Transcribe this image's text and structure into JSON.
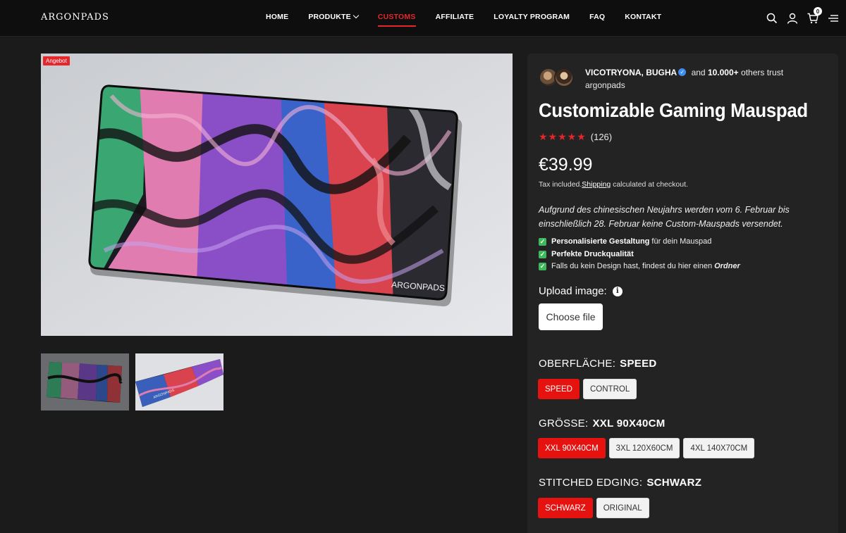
{
  "brand": {
    "logo": "ARGONPADS"
  },
  "nav": {
    "items": [
      {
        "label": "HOME"
      },
      {
        "label": "PRODUKTE"
      },
      {
        "label": "CUSTOMS"
      },
      {
        "label": "AFFILIATE"
      },
      {
        "label": "LOYALTY PROGRAM"
      },
      {
        "label": "FAQ"
      },
      {
        "label": "KONTAKT"
      }
    ],
    "active": "CUSTOMS",
    "cart_count": "0"
  },
  "gallery": {
    "sale_badge": "Angebot",
    "mousepad_brand": "ARGONPADS",
    "thumb_brand": "ARGONPADS"
  },
  "product": {
    "trust": {
      "names": "VICOTRYONA, BUGHA",
      "and": "and",
      "count": "10.000+",
      "rest": "others trust argonpads"
    },
    "title": "Customizable Gaming Mauspad",
    "stars": "★★★★★",
    "rating_count": "(126)",
    "price": "€39.99",
    "tax_prefix": "Tax included.",
    "tax_link": "Shipping",
    "tax_suffix": "calculated at checkout.",
    "notice": "Aufgrund des chinesischen Neujahrs werden vom 6. Februar bis einschließlich 28. Februar keine Custom-Mauspads versendet.",
    "features": [
      {
        "bold": "Personalisierte Gestaltung",
        "rest": "für dein Mauspad",
        "italic": ""
      },
      {
        "bold": "Perfekte Druckqualität",
        "rest": "",
        "italic": ""
      },
      {
        "bold": "",
        "rest": "Falls du kein Design hast, findest du hier einen",
        "italic": "Ordner"
      }
    ],
    "upload_label": "Upload image:",
    "choose_file": "Choose file",
    "options": {
      "surface": {
        "label": "OBERFLÄCHE:",
        "value": "SPEED",
        "choices": [
          "SPEED",
          "CONTROL"
        ]
      },
      "size": {
        "label": "GRÖSSE:",
        "value": "XXL 90X40CM",
        "choices": [
          "XXL 90X40CM",
          "3XL 120X60CM",
          "4XL 140X70CM"
        ]
      },
      "edging": {
        "label": "STITCHED EDGING:",
        "value": "SCHWARZ",
        "choices": [
          "SCHWARZ",
          "ORIGINAL"
        ]
      }
    }
  },
  "colors": {
    "accent": "#e5262b",
    "background": "#1b1b1b",
    "panel": "#232323",
    "check": "#3dbb5a"
  }
}
